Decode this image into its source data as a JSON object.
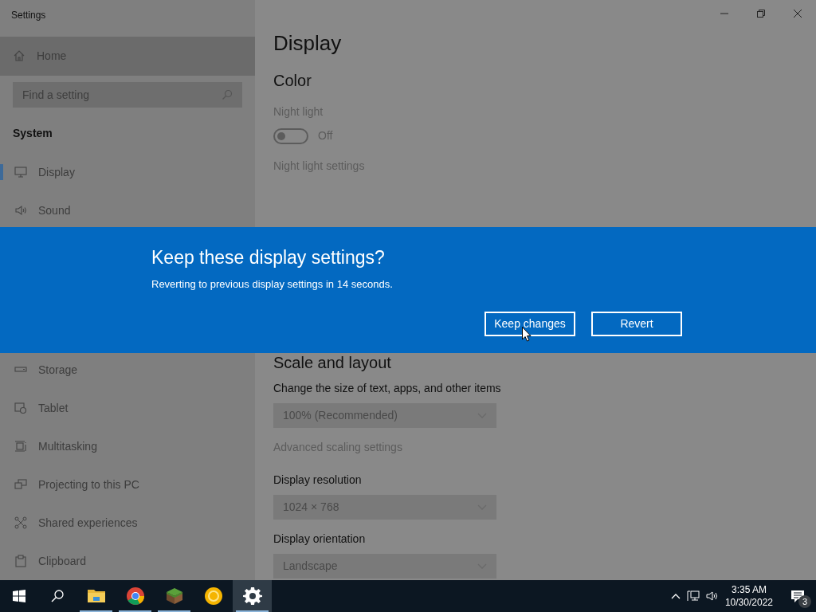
{
  "window": {
    "title": "Settings"
  },
  "sidebar": {
    "home": "Home",
    "search": {
      "placeholder": "Find a setting"
    },
    "section": "System",
    "items": [
      {
        "label": "Display",
        "kind": "monitor",
        "selected": true
      },
      {
        "label": "Sound",
        "kind": "speaker",
        "selected": false
      }
    ],
    "more_items": [
      {
        "label": "Storage",
        "kind": "drive",
        "selected": false
      },
      {
        "label": "Tablet",
        "kind": "tablet",
        "selected": false
      },
      {
        "label": "Multitasking",
        "kind": "multitask",
        "selected": false
      },
      {
        "label": "Projecting to this PC",
        "kind": "project",
        "selected": false
      },
      {
        "label": "Shared experiences",
        "kind": "shared",
        "selected": false
      },
      {
        "label": "Clipboard",
        "kind": "clipboard",
        "selected": false
      }
    ]
  },
  "main": {
    "title": "Display",
    "color_section": {
      "heading": "Color",
      "night_light_label": "Night light",
      "toggle": {
        "on": false,
        "label": "Off"
      },
      "link": "Night light settings"
    },
    "scale_section": {
      "heading": "Scale and layout",
      "size_label": "Change the size of text, apps, and other items",
      "size_value": "100% (Recommended)",
      "link": "Advanced scaling settings",
      "resolution_label": "Display resolution",
      "resolution_value": "1024 × 768",
      "orientation_label": "Display orientation",
      "orientation_value": "Landscape"
    }
  },
  "dialog": {
    "title": "Keep these display settings?",
    "message": "Reverting to previous display settings in 14 seconds.",
    "buttons": [
      "Keep changes",
      "Revert"
    ]
  },
  "taskbar": {
    "apps": [
      {
        "kind": "folder",
        "running": true,
        "selected": false
      },
      {
        "kind": "browser",
        "running": true,
        "selected": false
      },
      {
        "kind": "block",
        "running": true,
        "selected": false
      },
      {
        "kind": "ring",
        "running": false,
        "selected": false
      },
      {
        "kind": "gear",
        "running": true,
        "selected": true
      }
    ],
    "time": "3:35 AM",
    "date": "10/30/2022",
    "notifications": "3"
  }
}
